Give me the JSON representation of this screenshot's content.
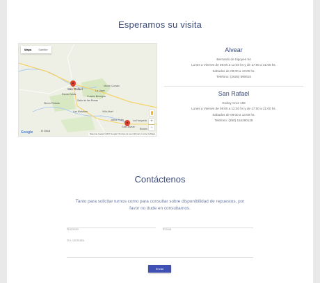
{
  "visit": {
    "title": "Esperamos su visita"
  },
  "map": {
    "type_buttons": [
      "Mapa",
      "Satélite"
    ],
    "place_labels": {
      "san_rafael": "San Rafael",
      "rama_caida": "Rama Caída",
      "cuadro_benegas": "Cuadro Benegas",
      "salto_de_las_rosas": "Salto de las Rosas",
      "villa_atuel": "Villa Atuel",
      "la_llave": "La Llave",
      "monte_comán": "Monte Comán",
      "las_malvinas": "Las Malvinas",
      "jaime_prats": "Jaime Prats",
      "la_horqueta": "La Horqueta",
      "gral_alvear": "Gral. Alvear",
      "bowen": "Bowen",
      "el_nihuil": "El Nihuil",
      "sierra_pintada": "Sierra Pintada"
    },
    "zoom_in": "+",
    "zoom_out": "−",
    "logo": "Google",
    "footer": "Datos de mapas ©2017 Google   Términos de uso   Informar un error de Maps",
    "colors": {
      "pin": "#d9412f",
      "water": "#a9c8f0",
      "road": "#f6d36b",
      "green": "#cfe3b8"
    }
  },
  "branches": [
    {
      "name": "Alvear",
      "lines": [
        "Bernardo de Irigoyen 54",
        "Lunes a Viernes de 09:00 a 12:30 hs y de 17:00 a 21:00 hs.",
        "Sabados de 09:00 a 13:00 hs.",
        "Telefono: (2625) 590615"
      ]
    },
    {
      "name": "San Rafael",
      "lines": [
        "Godoy Cruz 169",
        "Lunes a Viernes de 09:00 a 12:30 hs y de 17:00 a 21:00 hs.",
        "Sabados de 09:00 a 13:00 hs.",
        "Telefono: (260) 154290128"
      ]
    }
  ],
  "contact": {
    "title": "Contáctenos",
    "intro": "Tanto para solicitar turnos como para consultar sobre disponibilidad de repuestos, por favor no dude en consultarnos.",
    "name_placeholder": "Nombre",
    "email_placeholder": "Email",
    "message_placeholder": "Su consulta",
    "submit_label": "Enviar",
    "accent": "#3f51b5"
  }
}
